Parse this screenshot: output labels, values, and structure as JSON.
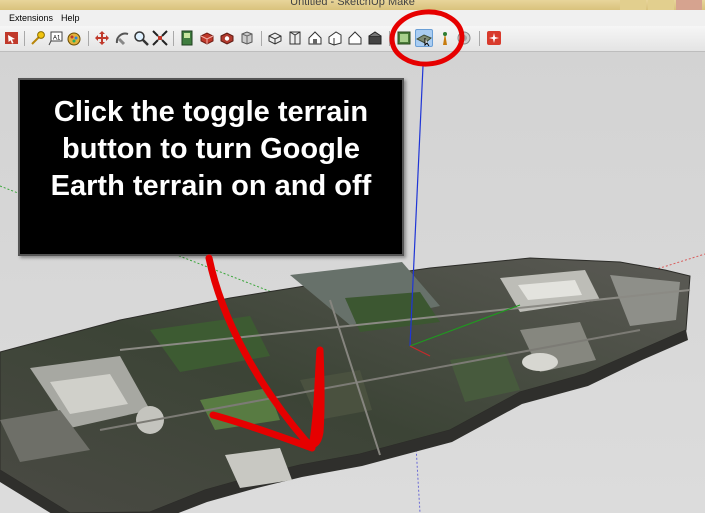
{
  "window": {
    "title": "Untitled - SketchUp Make"
  },
  "menubar": {
    "items": [
      "Extensions",
      "Help"
    ]
  },
  "toolbar": {
    "buttons": [
      "select-icon",
      "component-icon",
      "text-icon",
      "paint-icon",
      "move-icon",
      "orbit-icon",
      "zoom-icon",
      "zoom-extents-icon",
      "photo-textures-icon",
      "3d-warehouse-icon",
      "extension-warehouse-icon",
      "iso-view-icon",
      "top-view-icon",
      "front-view-icon",
      "right-view-icon",
      "back-view-icon",
      "left-view-icon",
      "add-location-icon",
      "toggle-terrain-icon",
      "preview-in-google-earth-icon",
      "share-model-icon",
      "ruby-console-icon"
    ],
    "pressed": "toggle-terrain-icon"
  },
  "callout": {
    "text": "Click the toggle terrain button to turn Google Earth terrain on and off"
  },
  "colors": {
    "highlight": "#e60000",
    "axis_blue": "#1f35d6",
    "axis_green": "#1f9a1f",
    "callout_bg": "#000000",
    "callout_text": "#ffffff"
  }
}
